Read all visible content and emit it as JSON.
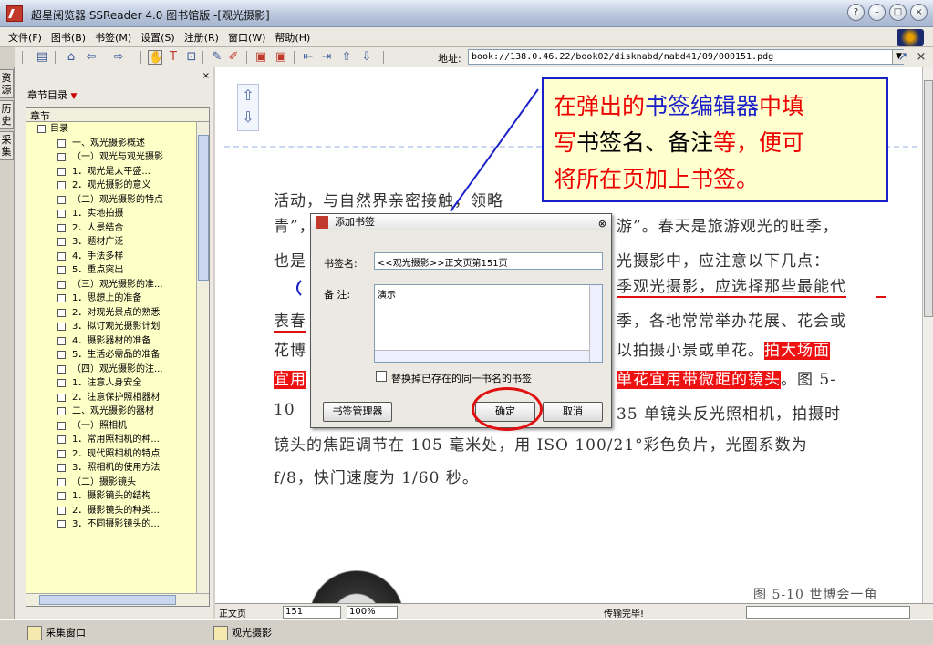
{
  "window": {
    "title": "超星阅览器 SSReader 4.0 图书馆版 -[观光摄影]"
  },
  "menu": [
    "文件(F)",
    "图书(B)",
    "书签(M)",
    "设置(S)",
    "注册(R)",
    "窗口(W)",
    "帮助(H)"
  ],
  "toolbar": {
    "address_label": "地址:",
    "address_value": "book://138.0.46.22/book02/disknabd/nabd41/09/000151.pdg"
  },
  "left_tabs": [
    "资源",
    "历史",
    "采集"
  ],
  "panel": {
    "header": "章节目录",
    "tree_header": "章节",
    "items": [
      {
        "label": "目录",
        "level": 0
      },
      {
        "label": "一、观光摄影概述",
        "level": 1
      },
      {
        "label": "（一）观光与观光摄影",
        "level": 1
      },
      {
        "label": "1．观光是太平盛...",
        "level": 1
      },
      {
        "label": "2．观光摄影的意义",
        "level": 1
      },
      {
        "label": "（二）观光摄影的特点",
        "level": 1
      },
      {
        "label": "1．实地拍摄",
        "level": 1
      },
      {
        "label": "2．人景结合",
        "level": 1
      },
      {
        "label": "3．题材广泛",
        "level": 1
      },
      {
        "label": "4．手法多样",
        "level": 1
      },
      {
        "label": "5．重点突出",
        "level": 1
      },
      {
        "label": "（三）观光摄影的准...",
        "level": 1
      },
      {
        "label": "1．思想上的准备",
        "level": 1
      },
      {
        "label": "2．对观光景点的熟悉",
        "level": 1
      },
      {
        "label": "3．拟订观光摄影计划",
        "level": 1
      },
      {
        "label": "4．摄影器材的准备",
        "level": 1
      },
      {
        "label": "5．生活必需品的准备",
        "level": 1
      },
      {
        "label": "（四）观光摄影的注...",
        "level": 1
      },
      {
        "label": "1．注意人身安全",
        "level": 1
      },
      {
        "label": "2．注意保护照相器材",
        "level": 1
      },
      {
        "label": "二、观光摄影的器材",
        "level": 1
      },
      {
        "label": "（一）照相机",
        "level": 1
      },
      {
        "label": "1．常用照相机的种...",
        "level": 1
      },
      {
        "label": "2．现代照相机的特点",
        "level": 1
      },
      {
        "label": "3．照相机的使用方法",
        "level": 1
      },
      {
        "label": "（二）摄影镜头",
        "level": 1
      },
      {
        "label": "1．摄影镜头的结构",
        "level": 1
      },
      {
        "label": "2．摄影镜头的种类...",
        "level": 1
      },
      {
        "label": "3．不同摄影镜头的...",
        "level": 1
      }
    ]
  },
  "page": {
    "line1": "活动，与自然界亲密接触，领略",
    "line2_a": "青”，",
    "line2_b": "游”。春天是旅游观光的旺季，",
    "line3_a": "也是",
    "line3_b": "光摄影中，应注意以下几点：",
    "line4": "季观光摄影，应选择那些最能代",
    "line5_a": "表春",
    "line5_b": "季，各地常常举办花展、花会或",
    "line6_a": "花博",
    "line6_b": "以拍摄小景或单花。",
    "line6_hl": "拍大场面",
    "line7_hl_a": "宜用",
    "line7_hl_b": "单花宜用带微距的镜头",
    "line7_c": "。图 5-",
    "line8_a": "10",
    "line8_b": "35 单镜头反光照相机，拍摄时",
    "line9": "镜头的焦距调节在 105 毫米处，用 ISO 100/21°彩色负片，光圈系数为",
    "line10": "f/8，快门速度为 1/60 秒。",
    "caption": "图 5-10  世博会一角"
  },
  "callout": {
    "p1": "在弹出的",
    "p2": "书签编辑器",
    "p3": "中填",
    "p4": "写",
    "p5": "书签名、备注",
    "p6": "等，便可",
    "p7": "将所在页加上书签。"
  },
  "dialog": {
    "title": "添加书签",
    "name_label": "书签名:",
    "name_value": "<<观光摄影>>正文页第151页",
    "note_label": "备  注:",
    "note_value": "演示",
    "replace_label": "替换掉已存在的同一书名的书签",
    "manager_btn": "书签管理器",
    "ok_btn": "确定",
    "cancel_btn": "取消"
  },
  "status": {
    "page_type": "正文页",
    "page_num": "151",
    "zoom": "100%",
    "message": "传输完毕!"
  },
  "taskbar": {
    "collect": "采集窗口",
    "book": "观光摄影"
  },
  "colors": {
    "highlight": "#ee1111",
    "callout_border": "#1a20c8",
    "tree_bg": "#ffffc8"
  }
}
